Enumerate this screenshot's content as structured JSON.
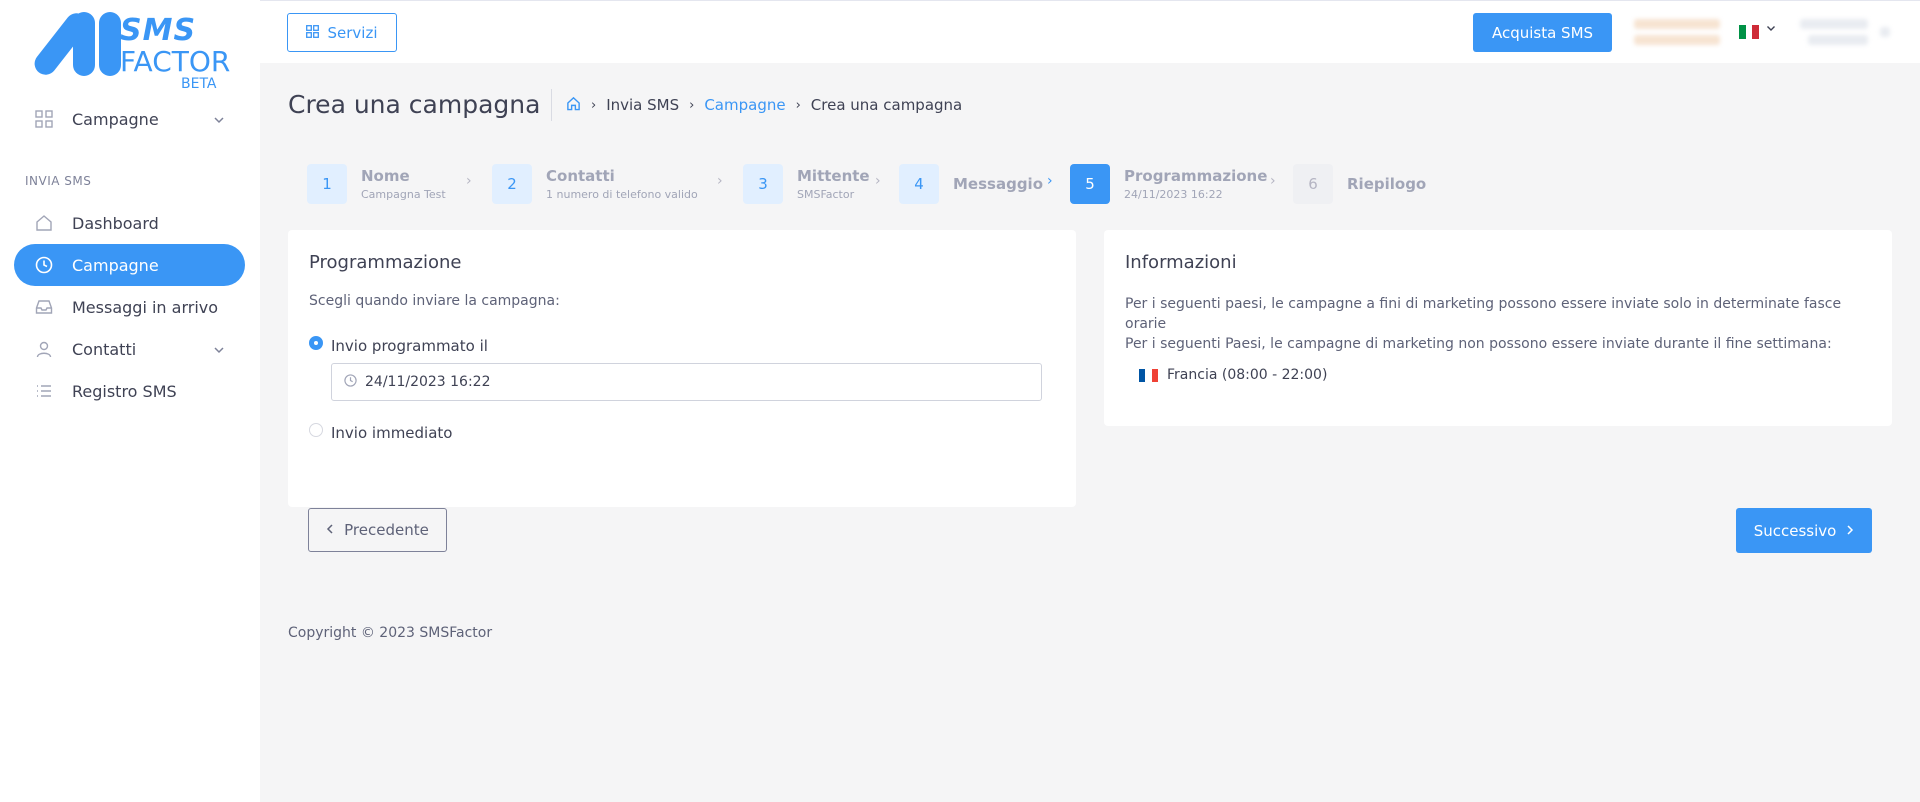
{
  "brand": {
    "line1": "SMS",
    "line2": "FACTOR",
    "line3": "BETA",
    "color": "#3a96f5"
  },
  "sidebar": {
    "top_item": {
      "label": "Campagne",
      "icon": "grid-icon"
    },
    "section_label": "INVIA SMS",
    "items": [
      {
        "label": "Dashboard",
        "icon": "home-icon",
        "active": false
      },
      {
        "label": "Campagne",
        "icon": "clock-icon",
        "active": true
      },
      {
        "label": "Messaggi in arrivo",
        "icon": "inbox-icon",
        "active": false
      },
      {
        "label": "Contatti",
        "icon": "user-icon",
        "active": false,
        "expandable": true
      },
      {
        "label": "Registro SMS",
        "icon": "list-icon",
        "active": false
      }
    ]
  },
  "header": {
    "servizi_label": "Servizi",
    "acquista_label": "Acquista SMS",
    "language": "it"
  },
  "page": {
    "title": "Crea una campagna",
    "breadcrumb": [
      "Invia SMS",
      "Campagne",
      "Crea una campagna"
    ]
  },
  "stepper": [
    {
      "num": "1",
      "label": "Nome",
      "sub": "Campagna Test",
      "state": "done"
    },
    {
      "num": "2",
      "label": "Contatti",
      "sub": "1 numero di telefono valido",
      "state": "done"
    },
    {
      "num": "3",
      "label": "Mittente",
      "sub": "SMSFactor",
      "state": "done"
    },
    {
      "num": "4",
      "label": "Messaggio",
      "sub": "",
      "state": "done"
    },
    {
      "num": "5",
      "label": "Programmazione",
      "sub": "24/11/2023 16:22",
      "state": "current"
    },
    {
      "num": "6",
      "label": "Riepilogo",
      "sub": "",
      "state": "future"
    }
  ],
  "programmazione": {
    "title": "Programmazione",
    "prompt": "Scegli quando inviare la campagna:",
    "option_scheduled": "Invio programmato il",
    "scheduled_value": "24/11/2023 16:22",
    "option_immediate": "Invio immediato",
    "selected": "scheduled"
  },
  "informazioni": {
    "title": "Informazioni",
    "line1": "Per i seguenti paesi, le campagne a fini di marketing possono essere inviate solo in determinate fasce orarie",
    "line2": "Per i seguenti Paesi, le campagne di marketing non possono essere inviate durante il fine settimana:",
    "country": "Francia (08:00 - 22:00)"
  },
  "buttons": {
    "previous": "Precedente",
    "next": "Successivo"
  },
  "footer": {
    "copyright": "Copyright © 2023 SMSFactor"
  }
}
